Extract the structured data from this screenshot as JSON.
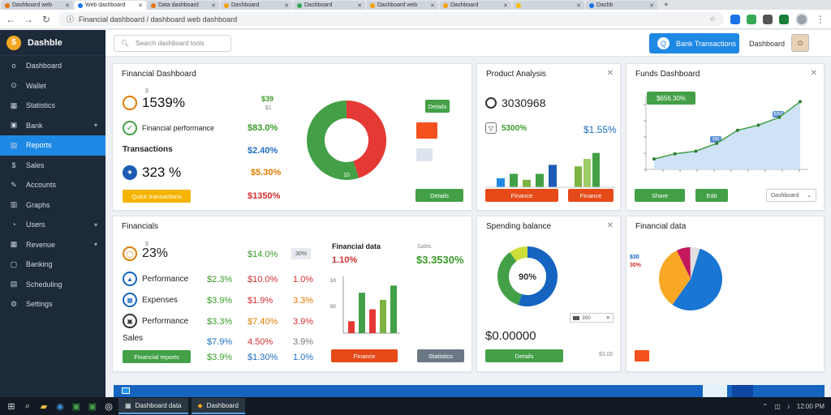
{
  "browser": {
    "tabs": [
      {
        "label": "Dashboard web",
        "active": false
      },
      {
        "label": "Web dashboard",
        "active": true
      },
      {
        "label": "Data dashboard",
        "active": false
      },
      {
        "label": "Dashboard",
        "active": false
      },
      {
        "label": "Dashboard",
        "active": false
      },
      {
        "label": "Dashboard web",
        "active": false
      },
      {
        "label": "Dashboard",
        "active": false
      },
      {
        "label": "",
        "active": false
      },
      {
        "label": "Dashb",
        "active": false
      }
    ],
    "new_tab": "+",
    "url": "Financial dashboard / dashboard web dashboard",
    "back": "←",
    "forward": "→",
    "reload": "↻"
  },
  "sidebar": {
    "brand": "Dashble",
    "items": [
      {
        "label": "Dashboard",
        "icon": "o"
      },
      {
        "label": "Wallet",
        "icon": "⊙"
      },
      {
        "label": "Statistics",
        "icon": "▦"
      },
      {
        "label": "Bank",
        "icon": "▣",
        "chevron": "▾"
      },
      {
        "label": "Reports",
        "icon": "▤",
        "active": true
      },
      {
        "label": "Sales",
        "icon": "$"
      },
      {
        "label": "Accounts",
        "icon": "✎"
      },
      {
        "label": "Graphs",
        "icon": "▥"
      },
      {
        "label": "Users",
        "icon": "◔",
        "chevron": "▾"
      },
      {
        "label": "Revenue",
        "icon": "▦",
        "chevron": "▾"
      },
      {
        "label": "Banking",
        "icon": "▢"
      },
      {
        "label": "Scheduling",
        "icon": "▤"
      },
      {
        "label": "Settings",
        "icon": "⚙"
      }
    ]
  },
  "topbar": {
    "search_placeholder": "Search dashboard tools",
    "button": "Bank Transactions",
    "user": "Dashboard"
  },
  "cards": {
    "c1": {
      "title": "Financial Dashboard",
      "rows": [
        {
          "icon": "⊙",
          "value": "1539%",
          "money": "$39",
          "small": "$1"
        },
        {
          "icon": "✓",
          "value": "Financial performance",
          "money": "$83.0%"
        },
        {
          "icon": "",
          "value": "Transactions",
          "money": "$2.40%"
        },
        {
          "icon": "✦",
          "value": "323 %",
          "money": "$5.30%"
        }
      ],
      "last_money": "$1350%",
      "yellow_btn": "Quick transactions",
      "green_btn": "Details",
      "mini_btn": "Details",
      "donut_label": "10",
      "donut": [
        {
          "value": 45,
          "color": "#e53935"
        },
        {
          "value": 55,
          "color": "#43a047"
        }
      ]
    },
    "c2": {
      "title": "Product Analysis",
      "value1": "3030968",
      "value2": "5300%",
      "money": "$1.55%",
      "btn1": "Finance",
      "btn2": "Finance",
      "bars": [
        {
          "value": 12,
          "color": "#1e88e5"
        },
        {
          "value": 18,
          "color": "#43a047"
        },
        {
          "value": 10,
          "color": "#7cb342"
        },
        {
          "value": 18,
          "color": "#43a047"
        },
        {
          "value": 30,
          "color": "#1e5bb5"
        },
        {
          "value": 28,
          "color": "#7cb342"
        },
        {
          "value": 38,
          "color": "#9ccc65"
        },
        {
          "value": 46,
          "color": "#43a047"
        }
      ]
    },
    "c3": {
      "title": "Funds Dashboard",
      "badge": "$656.30%",
      "tag1": "$360",
      "tag2": "200",
      "btn1": "Share",
      "btn2": "Edit",
      "select": "Dashboard",
      "x_ticks": [
        "",
        "",
        "",
        "",
        "",
        "",
        "",
        "",
        "",
        ""
      ],
      "y_ticks": [
        "",
        "",
        "",
        "",
        ""
      ],
      "line": [
        8,
        12,
        14,
        20,
        30,
        34,
        40,
        52
      ]
    },
    "c4": {
      "title": "Financials",
      "rows": [
        {
          "icon": "◯",
          "value": "23%",
          "money": "$14.0%",
          "money_color": "green",
          "tag": "30%"
        },
        {
          "icon": "▲",
          "value": "Performance",
          "money": "$2.3%",
          "money_color": "green",
          "m2": "$10.0%",
          "m2c": "red",
          "m3": "1.0%",
          "m3c": "red"
        },
        {
          "icon": "▦",
          "value": "Expenses",
          "money": "$3.9%",
          "money_color": "green",
          "m2": "$1.9%",
          "m2c": "red",
          "m3": "3.3%",
          "m3c": "orange"
        },
        {
          "icon": "▣",
          "value": "Performance",
          "money": "$3.3%",
          "money_color": "green",
          "m2": "$7.40%",
          "m2c": "orange",
          "m3": "3.9%",
          "m3c": "red"
        },
        {
          "icon": "",
          "value": "Sales",
          "money": "$7.9%",
          "money_color": "blue",
          "m2": "4.50%",
          "m2c": "red",
          "m3": "3.9%",
          "m3c": "gray"
        }
      ],
      "last_money": "$3.9%",
      "last_m2": "$1.30%",
      "last_m3": "1.0%",
      "btn_green": "Financial reports",
      "mid_title": "Financial data",
      "mid_small": "Sales",
      "mid_value": "1.10%",
      "mid_money": "$3.3530%",
      "orange_btn": "Finance",
      "gray_btn": "Statistics",
      "bars": [
        {
          "value": 10,
          "color": "#e53935"
        },
        {
          "value": 34,
          "color": "#43a047"
        },
        {
          "value": 20,
          "color": "#e53935"
        },
        {
          "value": 28,
          "color": "#7cb342"
        },
        {
          "value": 40,
          "color": "#43a047"
        }
      ],
      "y_ticks": [
        "10",
        "",
        "50",
        "",
        ""
      ]
    },
    "c5": {
      "title": "Spending balance",
      "center": "90%",
      "legend": "300",
      "money": "$0.00000",
      "btn": "Details",
      "small": "$3.00",
      "donut": [
        {
          "value": 55,
          "color": "#1565c0"
        },
        {
          "value": 35,
          "color": "#43a047"
        },
        {
          "value": 10,
          "color": "#cddc39"
        }
      ]
    },
    "c6": {
      "title": "Financial data",
      "legend": [
        {
          "label": "$30",
          "color": "#1565c0"
        },
        {
          "label": "30%",
          "color": "#d32f2f"
        }
      ],
      "pie": [
        {
          "value": 55,
          "color": "#1976d2"
        },
        {
          "value": 33,
          "color": "#f9a825"
        },
        {
          "value": 7,
          "color": "#c2185b"
        },
        {
          "value": 5,
          "color": "#e0e0e0"
        }
      ]
    }
  },
  "taskbar": {
    "app1": "Dashboard data",
    "app2": "Dashboard",
    "time": "12:00 PM"
  }
}
